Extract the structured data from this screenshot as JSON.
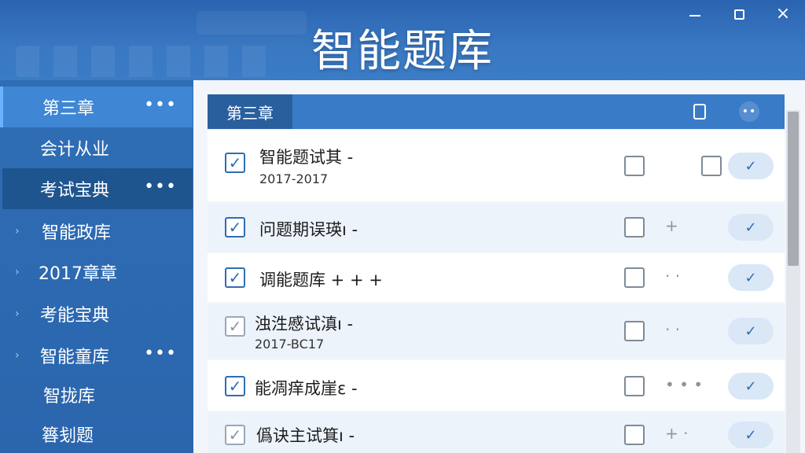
{
  "app": {
    "title": "智能题库"
  },
  "window_controls": {
    "minimize": "minimize",
    "maximize": "maximize",
    "close": "×"
  },
  "sidebar": {
    "items": [
      {
        "label": "第三章",
        "more": "•••"
      },
      {
        "label": "会计从业"
      },
      {
        "label": "考试宝典",
        "more": "•••"
      },
      {
        "label": "智能政库",
        "caret": "›"
      },
      {
        "label": "2017章章",
        "caret": "›"
      },
      {
        "label": "考能宝典",
        "caret": "›"
      },
      {
        "label": "智能童库",
        "caret": "›",
        "more": "•••"
      },
      {
        "label": "智拢库"
      },
      {
        "label": "簭刬题"
      }
    ]
  },
  "panel": {
    "tab_label": "第三章",
    "dots": "••"
  },
  "rows": [
    {
      "title": "智能题试其 -",
      "sub": "2017-2017",
      "mid": "",
      "check": "✓",
      "pill": "✓"
    },
    {
      "title": "问题期误瑛ı -",
      "sub": "",
      "mid": "+",
      "check": "✓",
      "pill": "✓"
    },
    {
      "title": "调能题库 + + +",
      "sub": "",
      "mid": "· ·",
      "check": "✓",
      "pill": "✓"
    },
    {
      "title": "浊泩慼试滇ı -",
      "sub": "2017-BC17",
      "mid": "· ·",
      "check": "✓",
      "pill": "✓"
    },
    {
      "title": "能凋痒成崖ε -",
      "sub": "",
      "mid": "• • •",
      "check": "✓",
      "pill": "✓"
    },
    {
      "title": "僞诀主试箕ı -",
      "sub": "",
      "mid": "+ ·",
      "check": "✓",
      "pill": "✓"
    }
  ],
  "colors": {
    "accent": "#2f6db5",
    "sidebar": "#2f6db5",
    "header": "#3a7bc8"
  }
}
